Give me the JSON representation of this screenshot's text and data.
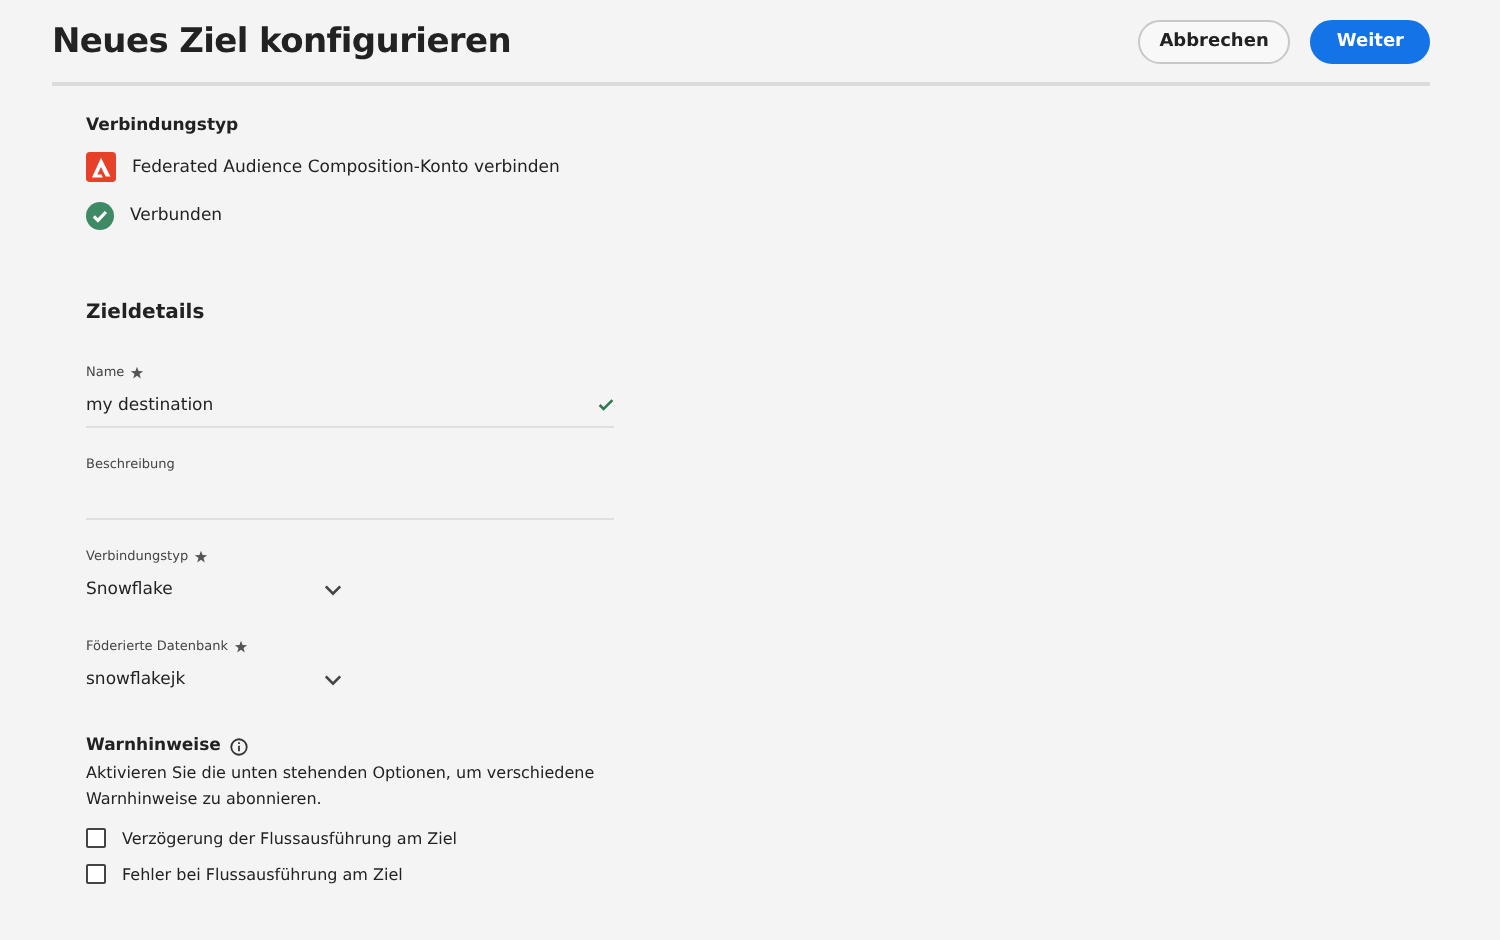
{
  "header": {
    "title": "Neues Ziel konfigurieren",
    "buttons": [
      {
        "label": "Abbrechen",
        "kind": "secondary"
      },
      {
        "label": "Weiter",
        "kind": "primary"
      }
    ]
  },
  "connection": {
    "heading": "Verbindungstyp",
    "account": "Federated Audience Composition-Konto verbinden",
    "status": "Verbunden"
  },
  "details": {
    "heading": "Zieldetails",
    "fields": [
      {
        "kind": "text",
        "label": "Name",
        "required": true,
        "value": "my destination",
        "valid": true
      },
      {
        "kind": "text",
        "label": "Beschreibung",
        "required": false,
        "valid": false
      },
      {
        "kind": "select",
        "label": "Verbindungstyp",
        "required": true,
        "value": "Snowflake"
      },
      {
        "kind": "select",
        "label": "Föderierte Datenbank",
        "required": true,
        "value": "snowflakejk"
      }
    ]
  },
  "alerts": {
    "heading": "Warnhinweise",
    "description": "Aktivieren Sie die unten stehenden Optionen, um verschiedene Warnhinweise zu abonnieren.",
    "options": [
      {
        "label": "Verzögerung der Flussausführung am Ziel",
        "checked": false
      },
      {
        "label": "Fehler bei Flussausführung am Ziel",
        "checked": false
      }
    ]
  }
}
